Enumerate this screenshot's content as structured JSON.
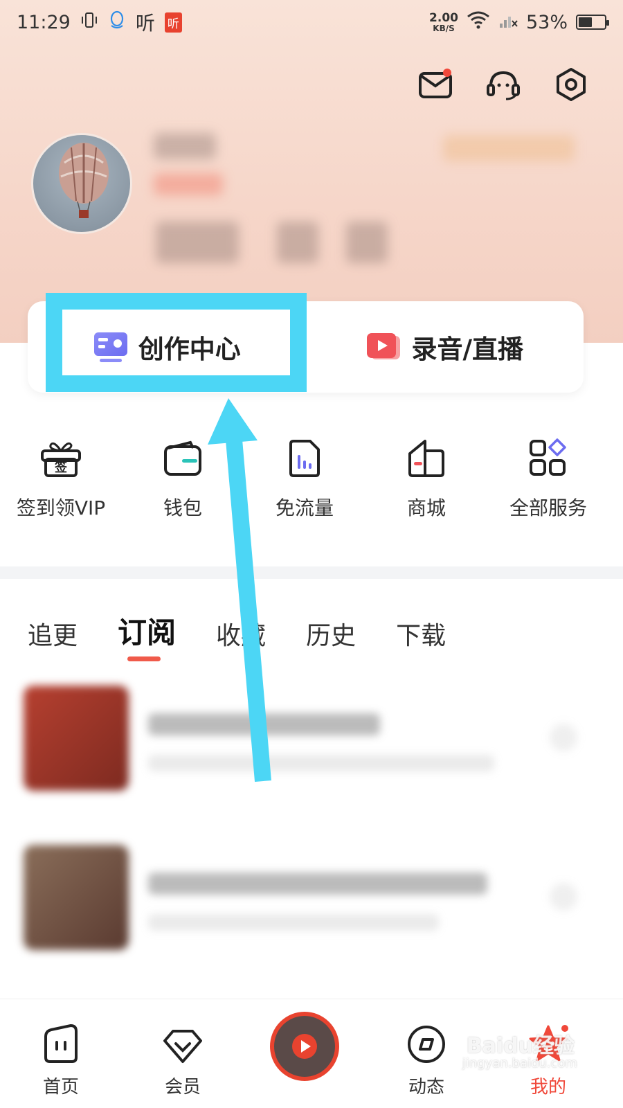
{
  "status_bar": {
    "time": "11:29",
    "app_tag": "听",
    "app_tag_red": "听",
    "net_speed_value": "2.00",
    "net_speed_unit": "KB/S",
    "battery": "53%",
    "battery_level": 0.53
  },
  "header": {
    "notification_badge": true
  },
  "action_card": {
    "create_center_label": "创作中心",
    "record_live_label": "录音/直播"
  },
  "services": [
    {
      "label": "签到领VIP",
      "icon": "gift-icon",
      "icon_text": "签"
    },
    {
      "label": "钱包",
      "icon": "wallet-icon"
    },
    {
      "label": "免流量",
      "icon": "data-free-icon"
    },
    {
      "label": "商城",
      "icon": "shop-icon"
    },
    {
      "label": "全部服务",
      "icon": "all-services-icon"
    }
  ],
  "tabs": [
    {
      "label": "追更",
      "active": false
    },
    {
      "label": "订阅",
      "active": true
    },
    {
      "label": "收藏",
      "active": false
    },
    {
      "label": "历史",
      "active": false
    },
    {
      "label": "下载",
      "active": false
    }
  ],
  "bottom_nav": [
    {
      "label": "首页",
      "icon": "home-icon"
    },
    {
      "label": "会员",
      "icon": "vip-icon"
    },
    {
      "label": "",
      "icon": "play-icon"
    },
    {
      "label": "动态",
      "icon": "feed-icon"
    },
    {
      "label": "我的",
      "icon": "mine-icon",
      "active": true
    }
  ],
  "watermark": {
    "text": "Baidu经验",
    "sub": "jingyan.baidu.com"
  },
  "colors": {
    "accent": "#f0483a",
    "highlight": "#4cd6f5",
    "header_bg": "#f9e3d8"
  }
}
